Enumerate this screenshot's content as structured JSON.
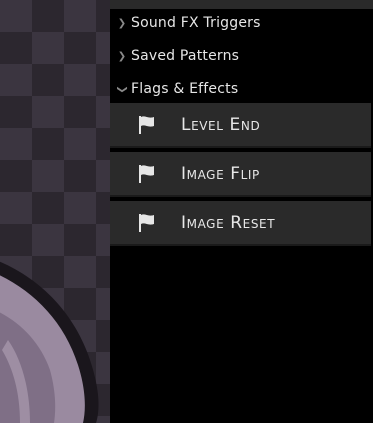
{
  "tree": {
    "sections": [
      {
        "label": "Sound FX Triggers",
        "expanded": false,
        "chevron": "chevron-right-icon"
      },
      {
        "label": "Saved Patterns",
        "expanded": false,
        "chevron": "chevron-right-icon"
      },
      {
        "label": "Flags & Effects",
        "expanded": true,
        "chevron": "chevron-down-icon"
      }
    ],
    "flag_items": [
      {
        "label": "Level End",
        "icon": "flag-icon"
      },
      {
        "label": "Image Flip",
        "icon": "flag-icon"
      },
      {
        "label": "Image Reset",
        "icon": "flag-icon"
      }
    ]
  },
  "colors": {
    "panel_bg": "#000000",
    "item_bg": "#2a2a2a",
    "text": "#e6e6e6",
    "chevron": "#8a8a8a",
    "checker_light": "#3b3540",
    "checker_dark": "#2c272f",
    "character_fill": "#9a8aa0"
  }
}
